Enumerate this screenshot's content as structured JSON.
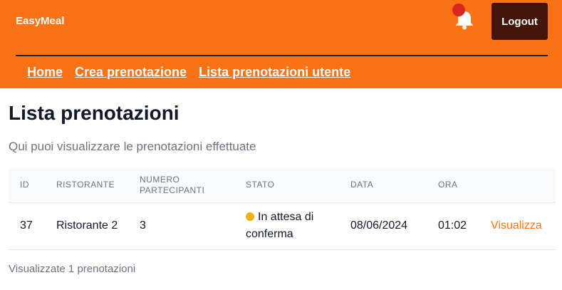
{
  "header": {
    "brand": "EasyMeal",
    "logout_label": "Logout",
    "notification_icon": "bell-icon",
    "notification_badge_color": "#dc2626",
    "background_color": "#f97316",
    "nav": [
      {
        "label": "Home"
      },
      {
        "label": "Crea prenotazione"
      },
      {
        "label": "Lista prenotazioni utente"
      }
    ]
  },
  "main": {
    "title": "Lista prenotazioni",
    "subtitle": "Qui puoi visualizzare le prenotazioni effettuate",
    "table": {
      "columns": [
        "ID",
        "RISTORANTE",
        "NUMERO PARTECIPANTI",
        "STATO",
        "DATA",
        "ORA",
        ""
      ],
      "rows": [
        {
          "id": "37",
          "restaurant": "Ristorante 2",
          "participants": "3",
          "status": "In attesa di conferma",
          "status_color": "#eab308",
          "date": "08/06/2024",
          "time": "01:02",
          "action": "Visualizza"
        }
      ]
    },
    "footer": "Visualizzate 1 prenotazioni"
  }
}
